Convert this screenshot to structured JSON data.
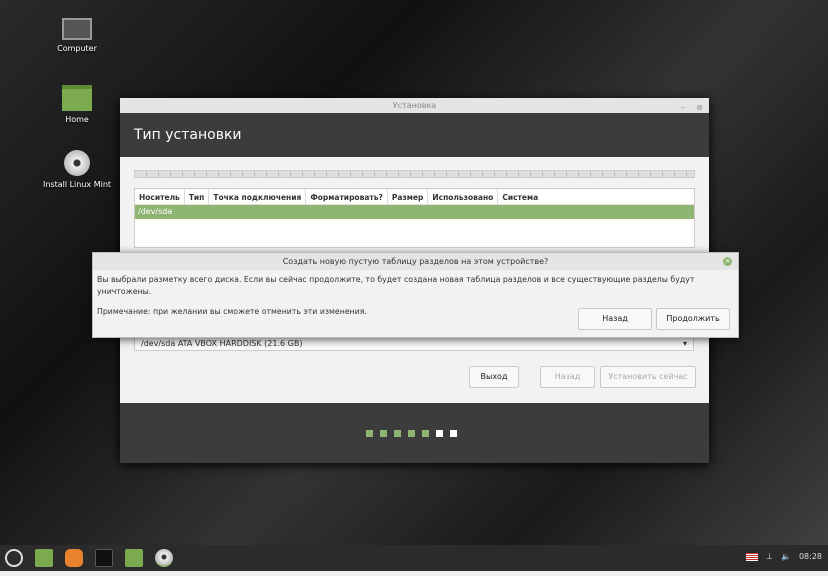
{
  "desktop": {
    "icons": [
      {
        "label": "Computer",
        "icon": "monitor-icon"
      },
      {
        "label": "Home",
        "icon": "folder-home-icon"
      },
      {
        "label": "Install Linux Mint",
        "icon": "disc-icon"
      }
    ]
  },
  "window": {
    "title": "Установка",
    "heading": "Тип установки",
    "columns": [
      "Носитель",
      "Тип",
      "Точка подключения",
      "Форматировать?",
      "Размер",
      "Использовано",
      "Система"
    ],
    "rows": [
      "/dev/sda"
    ],
    "device_select": "/dev/sda ATA VBOX HARDDISK (21.6 GB)",
    "buttons": {
      "quit": "Выход",
      "back": "Назад",
      "install": "Установить сейчас"
    },
    "progress": {
      "current_step": 5,
      "total_steps": 7
    }
  },
  "dialog": {
    "title": "Создать новую пустую таблицу разделов на этом устройстве?",
    "message": "Вы выбрали разметку всего диска. Если вы сейчас продолжите, то будет создана новая таблица разделов и все существующие разделы будут уничтожены.",
    "note": "Примечание: при желании вы сможете отменить эти изменения.",
    "back": "Назад",
    "continue": "Продолжить"
  },
  "taskbar": {
    "clock": "08:28"
  },
  "colors": {
    "accent": "#8fb573"
  }
}
